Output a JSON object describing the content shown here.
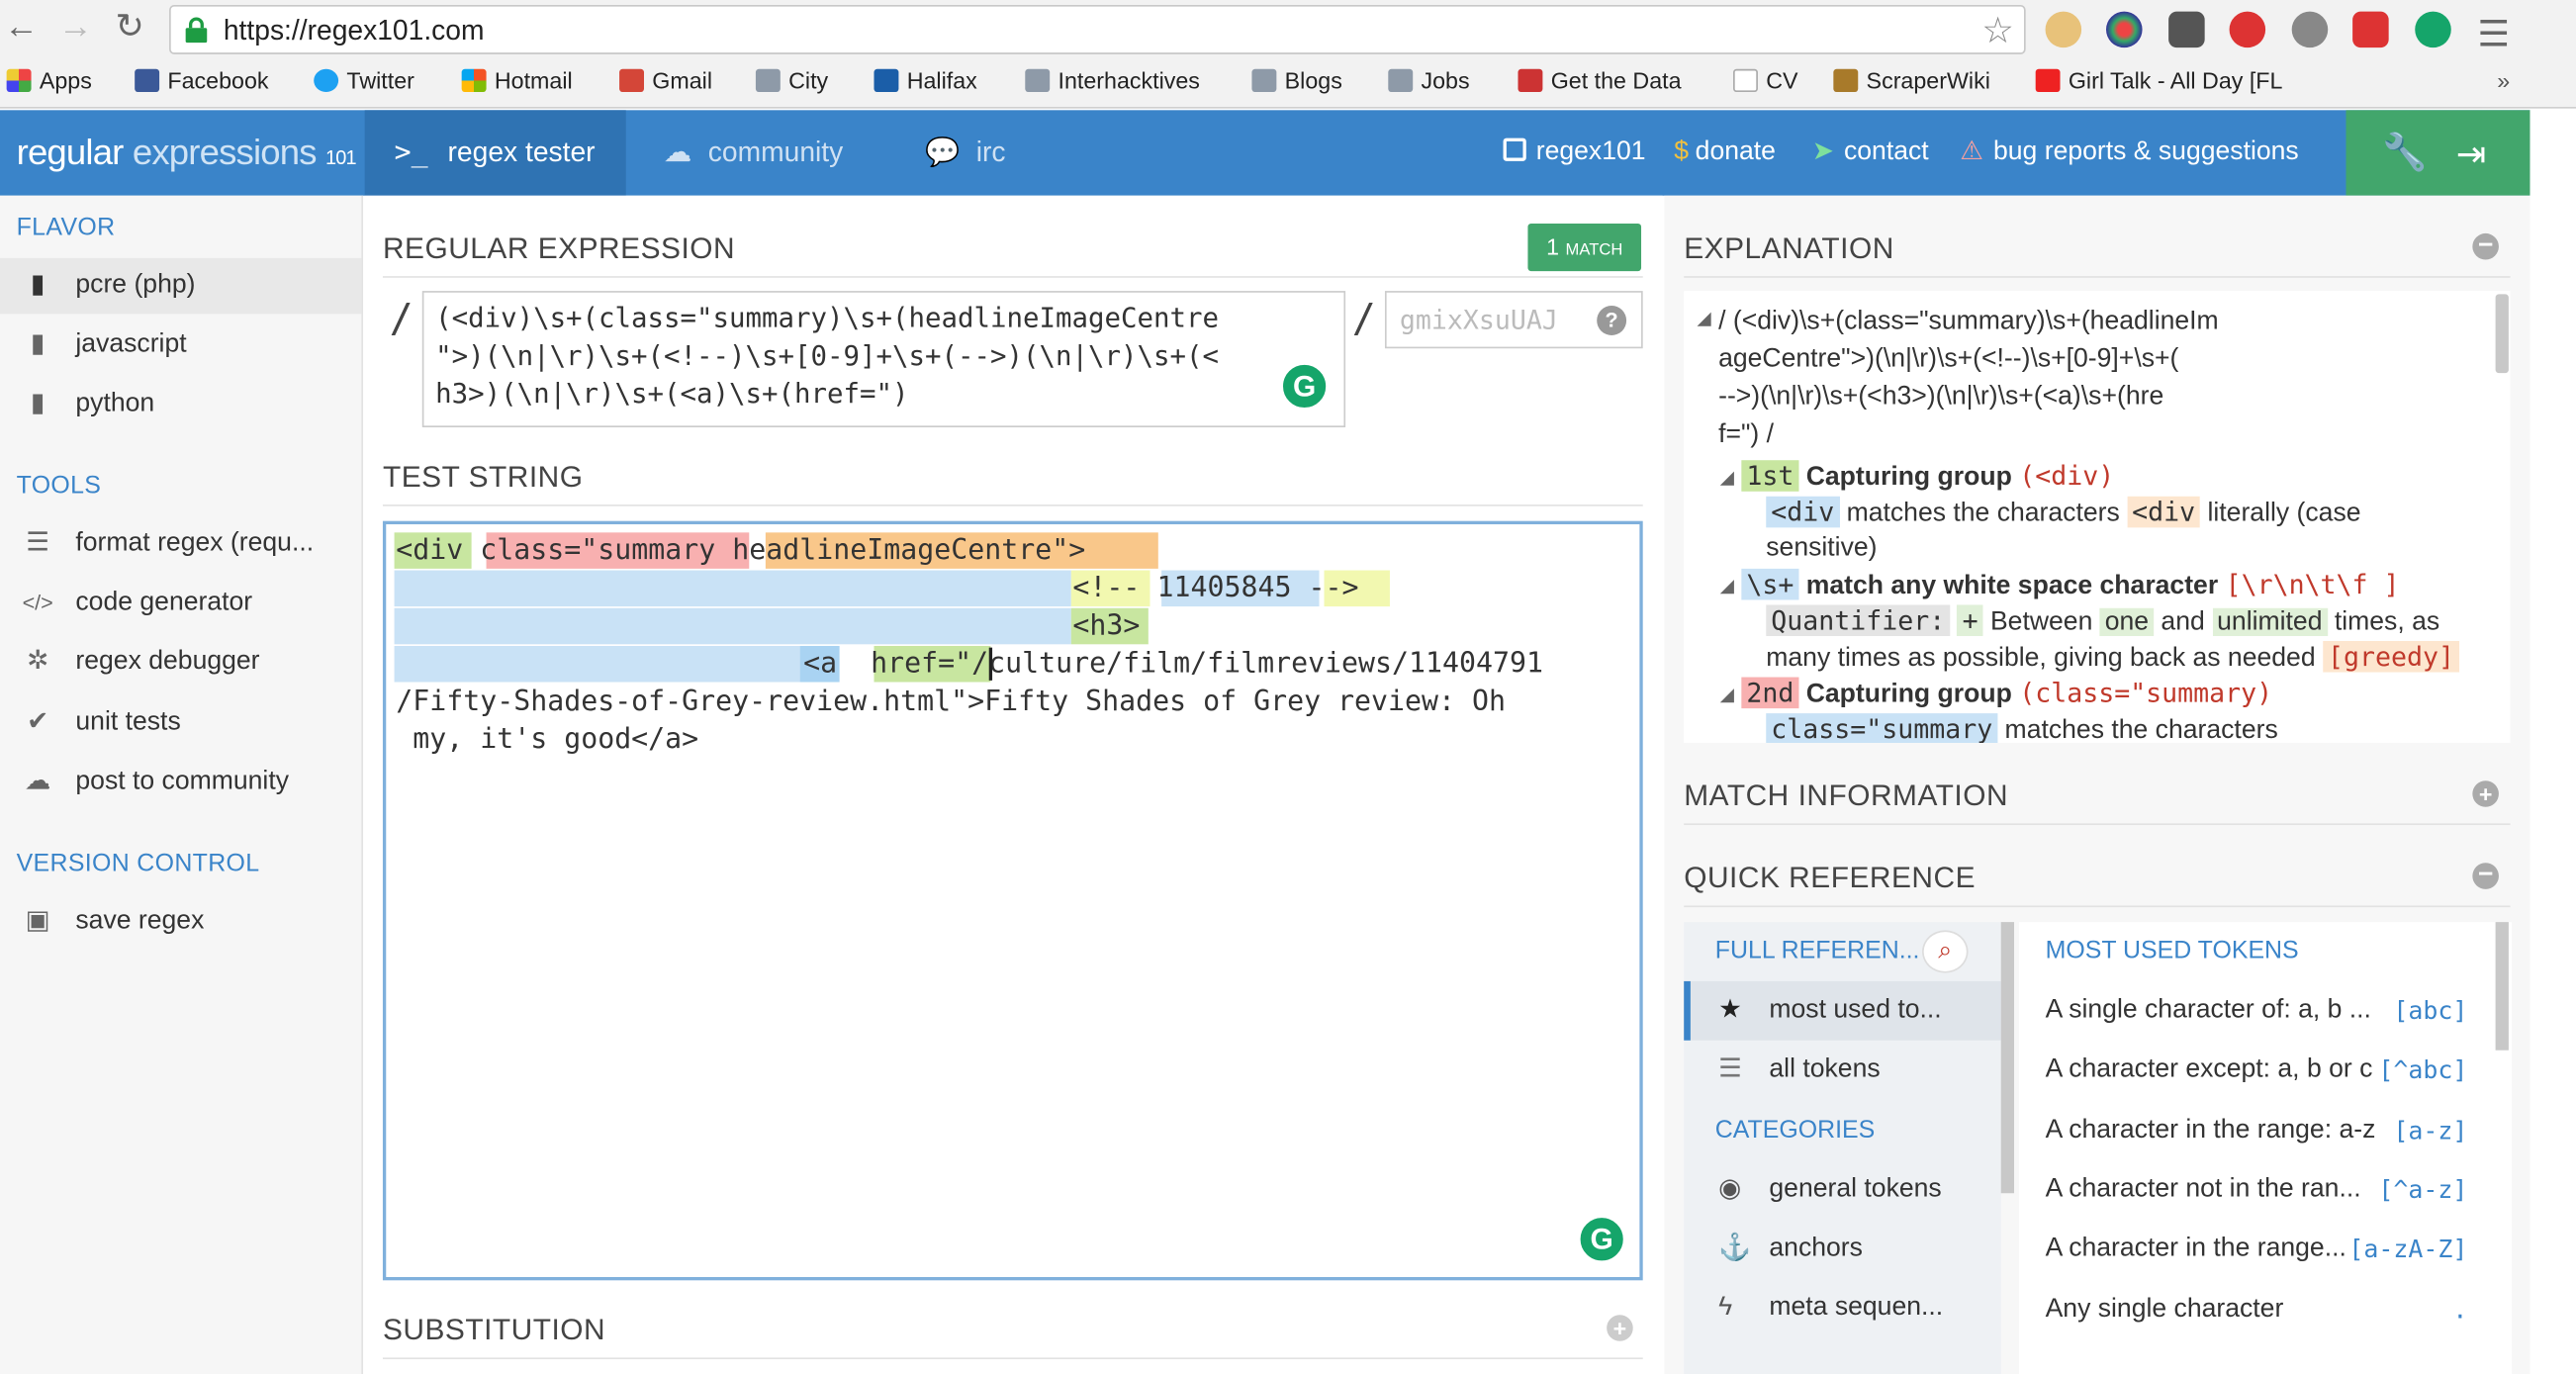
{
  "browser": {
    "url": "https://regex101.com",
    "bookmarks": [
      "Apps",
      "Facebook",
      "Twitter",
      "Hotmail",
      "Gmail",
      "City",
      "Halifax",
      "Interhacktives",
      "Blogs",
      "Jobs",
      "Get the Data",
      "CV",
      "ScraperWiki",
      "Girl Talk - All Day [FL"
    ],
    "overflow": "»"
  },
  "header": {
    "logo_main": "regular ",
    "logo_accent": "expressions",
    "logo_num": "101",
    "tabs": [
      "regex tester",
      "community",
      "irc"
    ],
    "links": [
      "regex101",
      "donate",
      "contact",
      "bug reports & suggestions"
    ]
  },
  "sidebar": {
    "flavor_heading": "FLAVOR",
    "flavors": [
      "pcre (php)",
      "javascript",
      "python"
    ],
    "tools_heading": "TOOLS",
    "tools": [
      "format regex (requ...",
      "code generator",
      "regex debugger",
      "unit tests",
      "post to community"
    ],
    "version_heading": "VERSION CONTROL",
    "version": [
      "save regex"
    ]
  },
  "regex": {
    "heading": "REGULAR EXPRESSION",
    "match_count": "1",
    "match_label": "MATCH",
    "lines": [
      "(<div)\\s+(class=\"summary)\\s+(headlineImageCentre",
      "\">)(\\n|\\r)\\s+(<!--)\\s+[0-9]+\\s+(-->)(\\n|\\r)\\s+(<",
      "h3>)(\\n|\\r)\\s+(<a)\\s+(href=\")"
    ],
    "flags_placeholder": "gmixXsuUAJ",
    "help": "?",
    "delim": "/"
  },
  "test": {
    "heading": "TEST STRING",
    "l1": [
      "<div",
      " ",
      "class=\"summary",
      " ",
      "headlineImageCentre\">"
    ],
    "l2": [
      "<!--",
      "11405845",
      "-->"
    ],
    "l3": "<h3>",
    "l4": [
      "<a",
      "href=\"",
      "/culture/film/filmreviews/11404791"
    ],
    "l5": "/Fifty-Shades-of-Grey-review.html\">Fifty Shades of Grey review: Oh",
    "l6": " my, it's good</a>"
  },
  "substitution": {
    "heading": "SUBSTITUTION"
  },
  "explanation": {
    "heading": "EXPLANATION",
    "regex_lines": [
      "/ (<div)\\s+(class=\"summary)\\s+(headlineIm",
      "ageCentre\">)(\\n|\\r)\\s+(<!--)\\s+[0-9]+\\s+(",
      "-->)(\\n|\\r)\\s+(<h3>)(\\n|\\r)\\s+(<a)\\s+(hre",
      "f=\") /"
    ],
    "g1_num": "1st",
    "g1_label": "Capturing group",
    "g1_tok": "(<div)",
    "g1_d_tok": "<div",
    "g1_d_a": " matches the characters ",
    "g1_d_tok2": "<div",
    "g1_d_b": " literally (case",
    "g1_d_c": "sensitive)",
    "ws_tok": "\\s+",
    "ws_label": "match any white space character",
    "ws_cls": "[\\r\\n\\t\\f ]",
    "q_label": "Quantifier:",
    "q_plus": "+",
    "q_a": " Between ",
    "q_one": "one",
    "q_b": " and ",
    "q_unl": "unlimited",
    "q_c": " times, as",
    "q_d": "many times as possible, giving back as needed ",
    "q_greedy": "[greedy]",
    "g2_num": "2nd",
    "g2_label": "Capturing group",
    "g2_tok": "(class=\"summary)",
    "g2_d_tok": "class=\"summary",
    "g2_d_a": " matches the characters"
  },
  "matchinfo": {
    "heading": "MATCH INFORMATION"
  },
  "quickref": {
    "heading": "QUICK REFERENCE",
    "full": "FULL REFEREN...",
    "nav": [
      "most used to...",
      "all tokens"
    ],
    "categories_heading": "CATEGORIES",
    "categories": [
      "general tokens",
      "anchors",
      "meta sequen..."
    ],
    "tokens_heading": "MOST USED TOKENS",
    "tokens": [
      {
        "d": "A single character of: a, b ...",
        "t": "[abc]"
      },
      {
        "d": "A character except: a, b or c",
        "t": "[^abc]"
      },
      {
        "d": "A character in the range: a-z",
        "t": "[a-z]"
      },
      {
        "d": "A character not in the ran...",
        "t": "[^a-z]"
      },
      {
        "d": "A character in the range...",
        "t": "[a-zA-Z]"
      },
      {
        "d": "Any single character",
        "t": "."
      }
    ]
  },
  "colors": {
    "brand": "#3a84c9",
    "green": "#42a66c",
    "accent_orange": "#e67e22"
  }
}
